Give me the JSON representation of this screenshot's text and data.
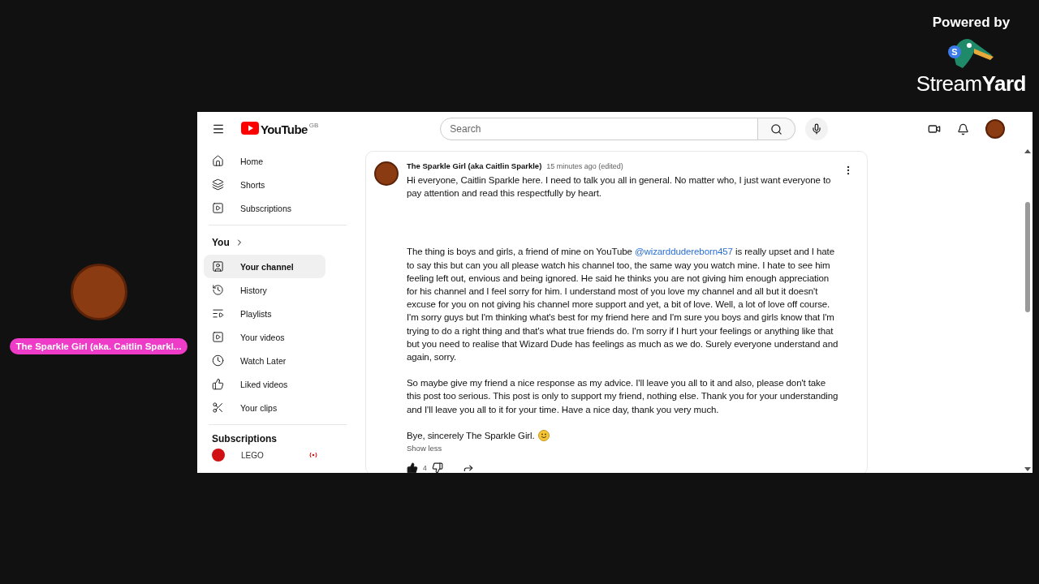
{
  "branding": {
    "caption": "Powered by",
    "badge": "S",
    "logo": "Stream**Yard**"
  },
  "participant": {
    "name": "The Sparkle Girl (aka. Caitlin Sparkl..."
  },
  "youtube": {
    "logo": "YouTube",
    "region": "GB",
    "search": {
      "placeholder": "Search"
    },
    "sidebar": {
      "main": [
        {
          "label": "Home",
          "selected": false
        },
        {
          "label": "Shorts",
          "selected": false
        },
        {
          "label": "Subscriptions",
          "selected": false
        }
      ],
      "you_heading": "You",
      "you_items": [
        {
          "label": "Your channel",
          "selected": true
        },
        {
          "label": "History",
          "selected": false
        },
        {
          "label": "Playlists",
          "selected": false
        },
        {
          "label": "Your videos",
          "selected": false
        },
        {
          "label": "Watch Later",
          "selected": false
        },
        {
          "label": "Liked videos",
          "selected": false
        },
        {
          "label": "Your clips",
          "selected": false
        }
      ],
      "subscriptions_heading": "Subscriptions",
      "channels": [
        {
          "name": "LEGO",
          "live": true
        }
      ]
    },
    "post": {
      "author": "The Sparkle Girl (aka Caitlin Sparkle)",
      "time": "15 minutes ago (edited)",
      "paragraphs": [
        [
          {
            "kind": "text",
            "text": "Hi everyone, Caitlin Sparkle here. I need to talk you all in general. No matter who, I just want everyone to pay attention and read this respectfully by heart."
          }
        ],
        [
          {
            "kind": "text",
            "text": "The thing is boys and girls, a friend of mine on YouTube "
          },
          {
            "kind": "mention",
            "text": "@wizarddudereborn457"
          },
          {
            "kind": "text",
            "text": " is really upset and I hate to say this but can you all please watch his channel too, the same way you watch mine. I hate to see him feeling left out, envious and being ignored. He said he thinks you are not giving him enough appreciation for his channel and I feel sorry for him. I understand most of you love my channel and all but it doesn't excuse for you on not giving his channel more support and yet, a bit of love. Well, a lot of love off course. I'm sorry guys but I'm thinking what's best for my friend here and I'm sure you boys and girls know that I'm trying to do a right thing and that's what true friends do. I'm sorry if I hurt your feelings or anything like that but you need to realise that Wizard Dude has feelings as much as we do. Surely everyone understand and again, sorry."
          }
        ],
        [
          {
            "kind": "text",
            "text": "So maybe give my friend a nice response as my advice. I'll leave you all to it and also, please don't take this post too serious. This post is only to support my friend, nothing else. Thank you for your understanding and I'll leave you all to it for your time. Have a nice day, thank you very much."
          }
        ],
        [
          {
            "kind": "text",
            "text": "Bye, sincerely The Sparkle Girl."
          },
          {
            "kind": "smiley"
          }
        ]
      ],
      "toggle": "Show less",
      "likes": "4",
      "liked": true
    }
  }
}
